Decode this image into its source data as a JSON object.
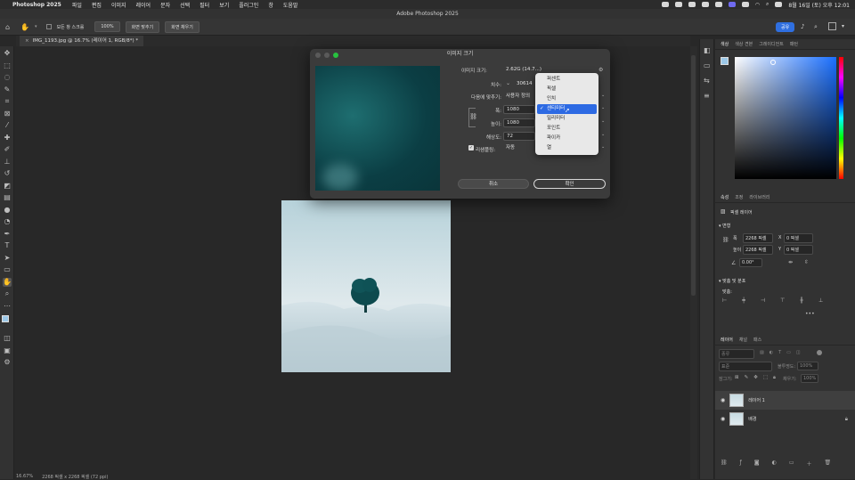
{
  "macbar": {
    "app": "Photoshop 2025",
    "menus": [
      "파일",
      "편집",
      "이미지",
      "레이어",
      "문자",
      "선택",
      "필터",
      "보기",
      "플러그인",
      "창",
      "도움말"
    ],
    "datetime": "8월 16일 (토) 오후 12:01"
  },
  "window": {
    "title": "Adobe Photoshop 2025"
  },
  "options": {
    "scroll_all_label": "모든 창 스크롤",
    "zoom_value": "100%",
    "fit_screen_label": "화면 맞추기",
    "fill_screen_label": "화면 채우기",
    "share_label": "공유"
  },
  "document_tab": {
    "label": "IMG_1193.jpg @ 16.7% (레이어 1, RGB/8*) *"
  },
  "dialog": {
    "title": "이미지 크기",
    "image_size_label": "이미지 크기:",
    "image_size_value": "2.62G (14.7...)",
    "dimensions_label": "치수:",
    "dimensions_value": "30614",
    "fit_to_label": "다음에 맞추기:",
    "fit_to_value": "사용자 정의",
    "width_label": "폭:",
    "width_value": "1080",
    "height_label": "높이:",
    "height_value": "1080",
    "resolution_label": "해상도:",
    "resolution_value": "72",
    "resample_label": "리샘플링:",
    "resample_value": "자동",
    "cancel_label": "취소",
    "ok_label": "확인"
  },
  "unit_dropdown": {
    "options": [
      "퍼센트",
      "픽셀",
      "인치",
      "센티미터",
      "밀리미터",
      "포인트",
      "파이카",
      "열"
    ],
    "selected_index": 3
  },
  "color_panel": {
    "tabs": [
      "색상",
      "색상 견본",
      "그레이디언트",
      "패턴"
    ],
    "foreground": "#9cc8e8",
    "background": "#ffffff",
    "hue_color": "#1a6fff"
  },
  "properties_panel": {
    "tabs": [
      "속성",
      "조정",
      "라이브러리"
    ],
    "layer_type": "픽셀 레이어",
    "transform_header": "변형",
    "w_label": "폭",
    "w_value": "2268 픽셀",
    "h_label": "높이",
    "h_value": "2268 픽셀",
    "x_label": "X",
    "x_value": "0 픽셀",
    "y_label": "Y",
    "y_value": "0 픽셀",
    "angle_value": "0.00°",
    "align_header": "맞춤 및 분포",
    "align_label": "맞춤:"
  },
  "layers_panel": {
    "tabs": [
      "레이어",
      "채널",
      "패스"
    ],
    "search_placeholder": "종류",
    "blend_mode": "표준",
    "opacity_label": "불투명도:",
    "opacity_value": "100%",
    "lock_label": "잠그기:",
    "fill_label": "채우기:",
    "fill_value": "100%",
    "layers": [
      {
        "name": "레이어 1",
        "selected": true
      },
      {
        "name": "배경",
        "selected": false
      }
    ]
  },
  "statusbar": {
    "zoom": "16.67%",
    "doc_info": "2268 픽셀 x 2268 픽셀 (72 ppi)"
  }
}
